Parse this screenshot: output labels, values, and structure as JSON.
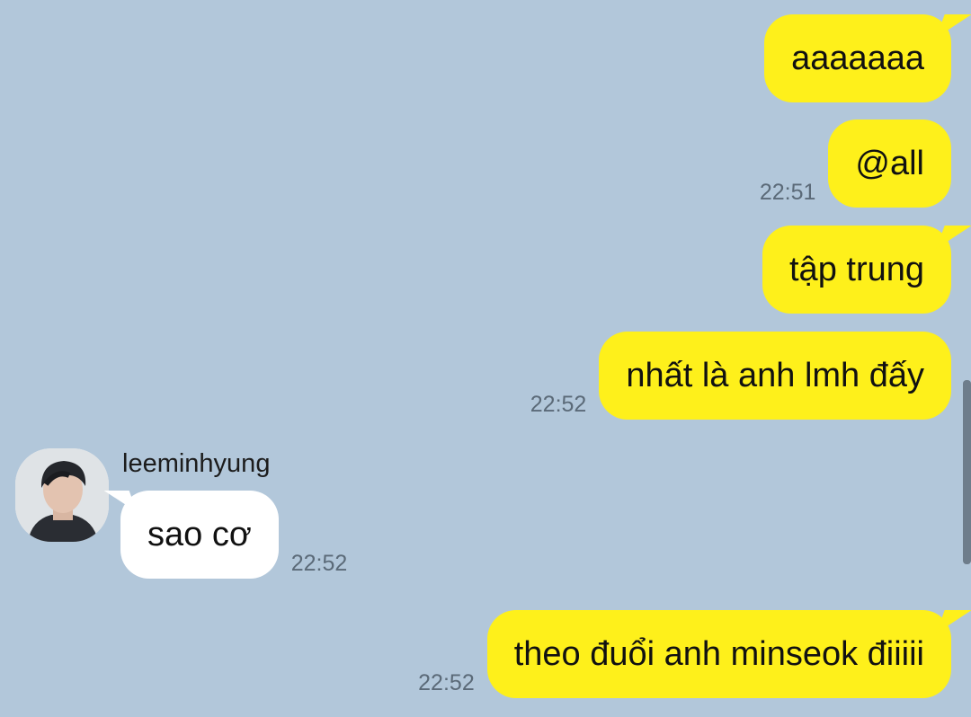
{
  "messages": [
    {
      "text": "aaaaaaa",
      "time": ""
    },
    {
      "text": "@all",
      "time": "22:51"
    },
    {
      "text": "tập trung",
      "time": ""
    },
    {
      "text": "nhất là anh lmh đấy",
      "time": "22:52"
    },
    {
      "sender": "leeminhyung",
      "text": "sao cơ",
      "time": "22:52"
    },
    {
      "text": "theo đuổi anh minseok điiiii",
      "time": "22:52"
    }
  ],
  "colors": {
    "background": "#b2c7da",
    "my_bubble": "#fef01b",
    "other_bubble": "#ffffff",
    "timestamp": "#5b6a78"
  },
  "icons": {
    "avatar": "profile-photo"
  }
}
